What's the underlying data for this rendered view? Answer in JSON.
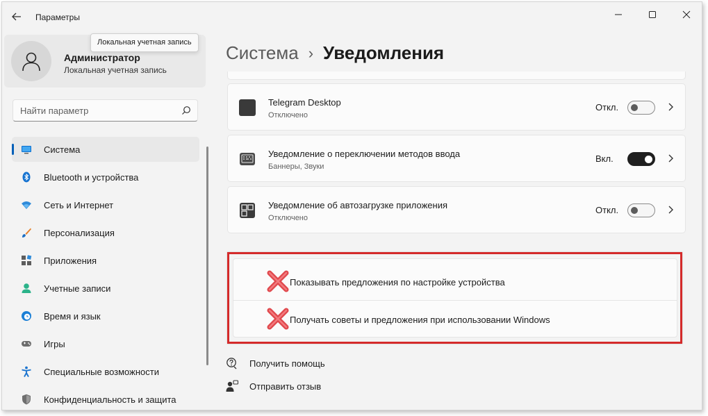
{
  "window": {
    "title": "Параметры"
  },
  "tooltip": "Локальная учетная запись",
  "account": {
    "name": "Администратор",
    "type": "Локальная учетная запись"
  },
  "search": {
    "placeholder": "Найти параметр"
  },
  "sidebar": {
    "items": [
      {
        "label": "Система",
        "icon": "monitor-icon",
        "active": true
      },
      {
        "label": "Bluetooth и устройства",
        "icon": "bluetooth-icon"
      },
      {
        "label": "Сеть и Интернет",
        "icon": "wifi-icon"
      },
      {
        "label": "Персонализация",
        "icon": "brush-icon"
      },
      {
        "label": "Приложения",
        "icon": "apps-icon"
      },
      {
        "label": "Учетные записи",
        "icon": "person-icon"
      },
      {
        "label": "Время и язык",
        "icon": "globe-clock-icon"
      },
      {
        "label": "Игры",
        "icon": "gamepad-icon"
      },
      {
        "label": "Специальные возможности",
        "icon": "accessibility-icon"
      },
      {
        "label": "Конфиденциальность и защита",
        "icon": "shield-icon"
      }
    ]
  },
  "breadcrumb": {
    "parent": "Система",
    "separator": "›",
    "current": "Уведомления"
  },
  "apps": [
    {
      "name": "Telegram Desktop",
      "sub": "Отключено",
      "state_label": "Откл.",
      "on": false,
      "icon": "telegram-app-icon"
    },
    {
      "name": "Уведомление о переключении методов ввода",
      "sub": "Баннеры, Звуки",
      "state_label": "Вкл.",
      "on": true,
      "icon": "keyboard-icon"
    },
    {
      "name": "Уведомление об автозагрузке приложения",
      "sub": "Отключено",
      "state_label": "Откл.",
      "on": false,
      "icon": "startup-apps-icon"
    }
  ],
  "suggestions": [
    {
      "label": "Показывать предложения по настройке устройства"
    },
    {
      "label": "Получать советы и предложения при использовании Windows"
    }
  ],
  "links": [
    {
      "label": "Получить помощь",
      "icon": "help-icon"
    },
    {
      "label": "Отправить отзыв",
      "icon": "feedback-icon"
    }
  ],
  "colors": {
    "accent": "#005fb8",
    "highlight_box": "#d42a2a",
    "cross_mark": "#e0484d"
  }
}
